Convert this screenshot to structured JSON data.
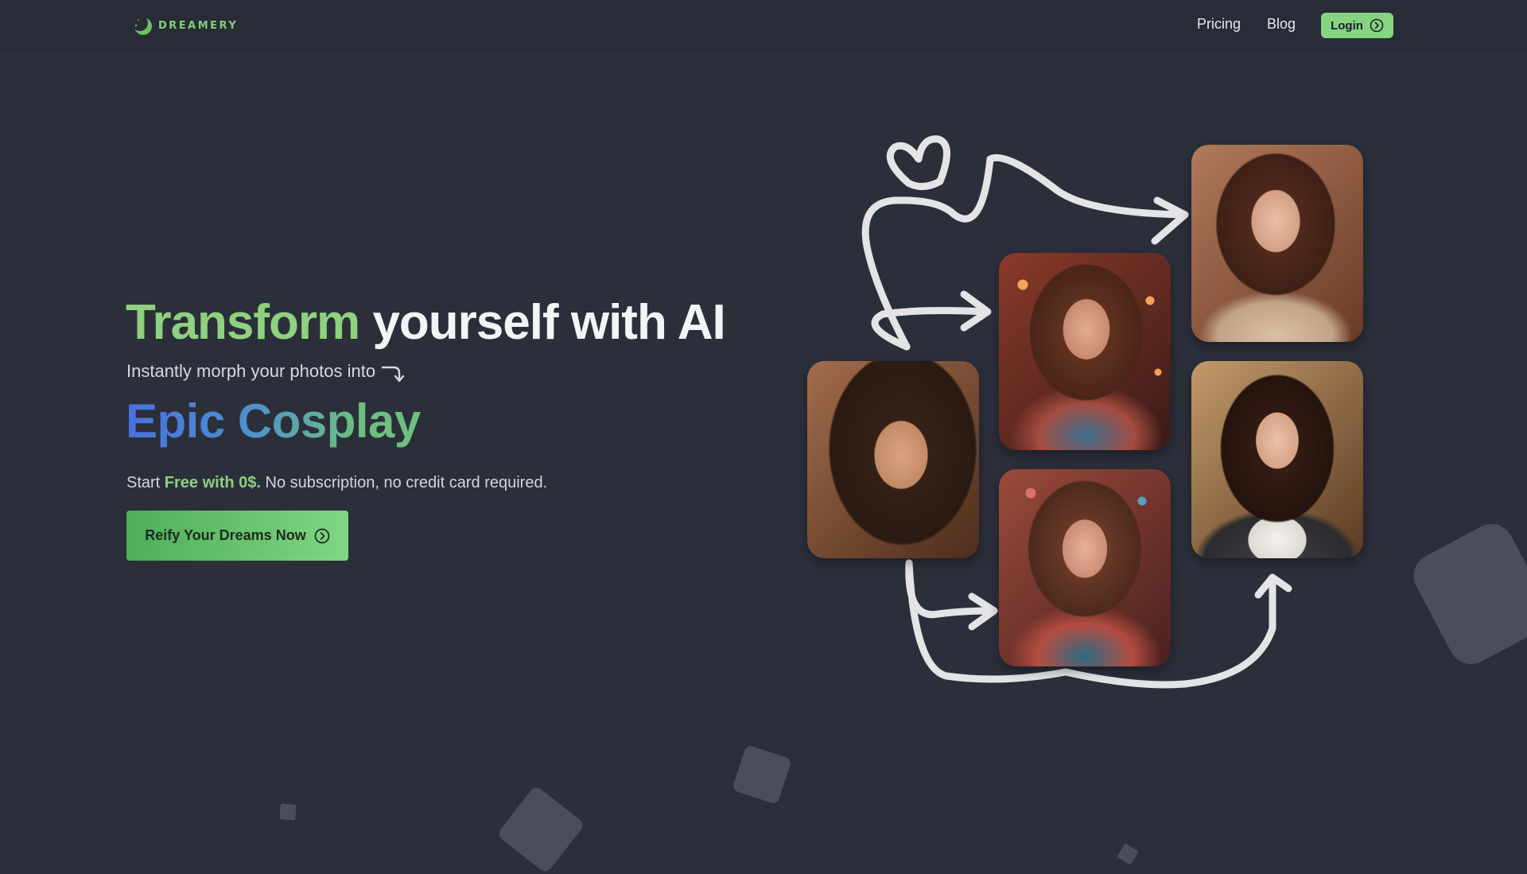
{
  "nav": {
    "brand": "DREAMERY",
    "links": {
      "pricing": "Pricing",
      "blog": "Blog"
    },
    "login_label": "Login"
  },
  "hero": {
    "title_accent": "Transform",
    "title_rest": "yourself with AI",
    "subtitle": "Instantly morph your photos into",
    "highlight": "Epic Cosplay",
    "start_prefix": "Start ",
    "start_free": "Free with 0$.",
    "start_suffix": " No subscription, no credit card required.",
    "cta_label": "Reify Your Dreams Now"
  },
  "colors": {
    "background": "#2b2f3a",
    "accent_green": "#86d480",
    "gradient_blue": "#4a6fe0"
  },
  "icons": {
    "logo": "moon-icon",
    "login": "circle-arrow-right-icon",
    "cta": "circle-arrow-right-icon",
    "subtitle": "curved-arrow-down-icon"
  }
}
